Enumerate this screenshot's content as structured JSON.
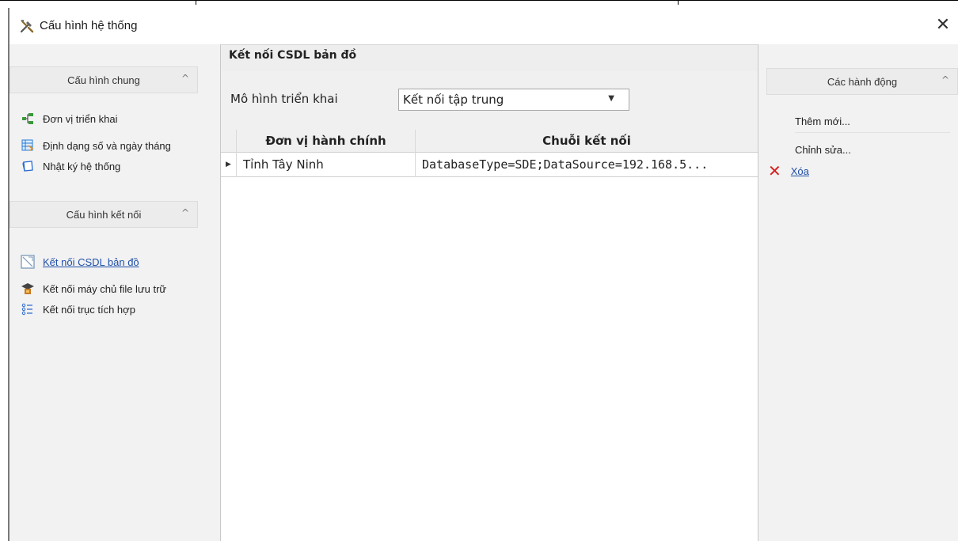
{
  "window": {
    "title": "Cấu hình hệ thống",
    "close_glyph": "✕"
  },
  "left": {
    "groups": [
      {
        "title": "Cấu hình chung",
        "items": [
          {
            "label": "Đơn vị triển khai",
            "icon": "org-tree-icon"
          },
          {
            "label": "Định dạng số và ngày tháng",
            "icon": "table-format-icon"
          },
          {
            "label": "Nhật ký hệ thống",
            "icon": "log-book-icon"
          }
        ]
      },
      {
        "title": "Cấu hình kết nối",
        "items": [
          {
            "label": "Kết nối CSDL bản đồ",
            "icon": "map-db-icon",
            "active": true
          },
          {
            "label": "Kết nối máy chủ file lưu trữ",
            "icon": "file-server-icon"
          },
          {
            "label": "Kết nối trục tích hợp",
            "icon": "integration-bus-icon"
          }
        ]
      }
    ]
  },
  "center": {
    "title": "Kết nối CSDL bản đồ",
    "deploy_model_label": "Mô hình triển khai",
    "deploy_model_value": "Kết nối tập trung",
    "grid": {
      "columns": [
        "Đơn vị hành chính",
        "Chuỗi kết nối"
      ],
      "rows": [
        {
          "admin_unit": "Tỉnh Tây Ninh",
          "connection_string": "DatabaseType=SDE;DataSource=192.168.5..."
        }
      ]
    }
  },
  "right": {
    "title": "Các hành động",
    "actions": {
      "add": "Thêm mới...",
      "edit": "Chỉnh sửa...",
      "delete": "Xóa"
    }
  },
  "colors": {
    "link": "#1f4fa8",
    "delete_icon": "#d62020",
    "panel_bg": "#f2f2f2"
  }
}
